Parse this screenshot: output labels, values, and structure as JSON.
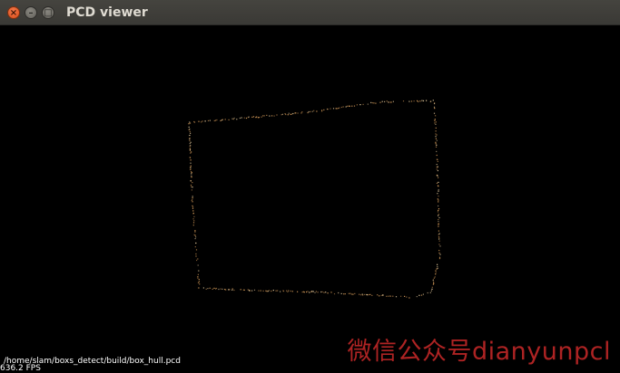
{
  "window": {
    "title": "PCD viewer",
    "buttons": {
      "close": "×",
      "minimize": "–",
      "maximize": "□"
    }
  },
  "viewer": {
    "file_path": "/home/slam/boxs_detect/build/box_hull.pcd",
    "fps": "636.2 FPS",
    "background_color": "#000000",
    "point_color": "#d49a58"
  },
  "watermark": {
    "text": "微信公众号dianyunpcl"
  }
}
